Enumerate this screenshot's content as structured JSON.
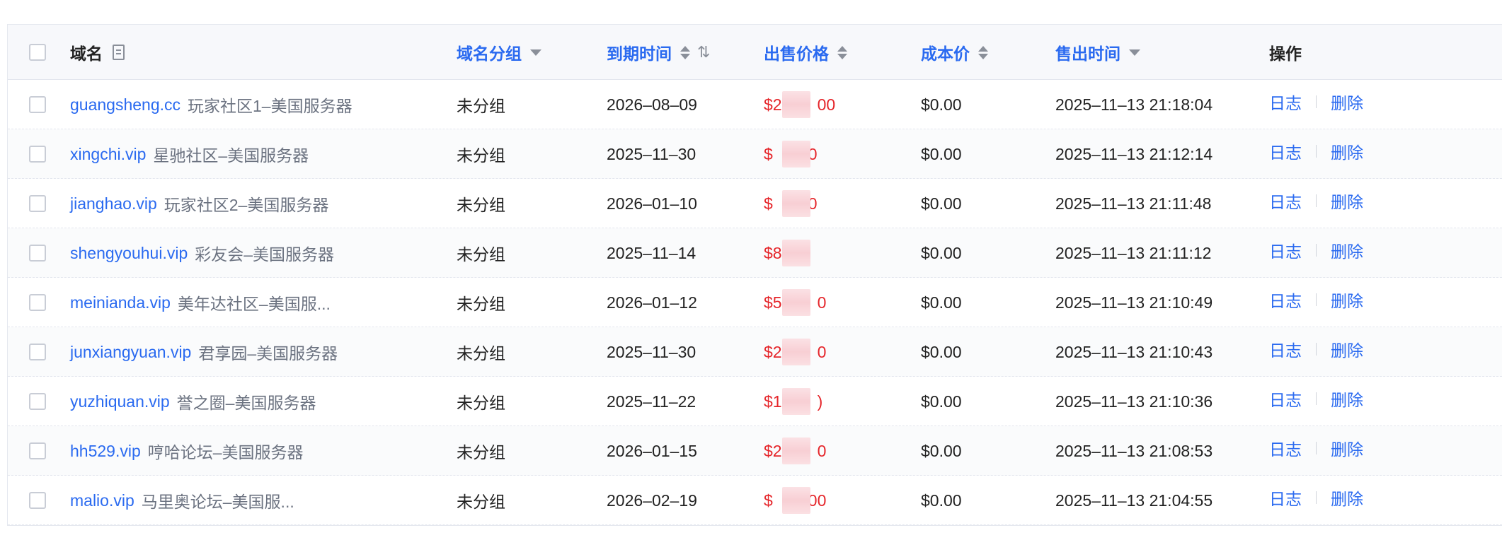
{
  "header": {
    "domain": "域名",
    "group": "域名分组",
    "expiry": "到期时间",
    "price": "出售价格",
    "cost": "成本价",
    "sold_time": "售出时间",
    "actions": "操作"
  },
  "icons": {
    "note": "note-icon",
    "filter": "caret-down-icon",
    "sort": "sort-icon",
    "sort_alt": "sort-alt-icon"
  },
  "colors": {
    "link": "#2a6af0",
    "price": "#e5252a",
    "header_bg": "#f7f8fb"
  },
  "rows": [
    {
      "domain": "guangsheng.cc",
      "note": "玩家社区1–美国服务器",
      "group": "未分组",
      "expiry": "2026–08–09",
      "price_prefix": "$2",
      "price_suffix": "00",
      "cost": "$0.00",
      "sold": "2025–11–13 21:18:04",
      "log": "日志",
      "delete": "删除"
    },
    {
      "domain": "xingchi.vip",
      "note": "星驰社区–美国服务器",
      "group": "未分组",
      "expiry": "2025–11–30",
      "price_prefix": "$",
      "price_suffix": "0",
      "cost": "$0.00",
      "sold": "2025–11–13 21:12:14",
      "log": "日志",
      "delete": "删除"
    },
    {
      "domain": "jianghao.vip",
      "note": "玩家社区2–美国服务器",
      "group": "未分组",
      "expiry": "2026–01–10",
      "price_prefix": "$",
      "price_suffix": "0",
      "cost": "$0.00",
      "sold": "2025–11–13 21:11:48",
      "log": "日志",
      "delete": "删除"
    },
    {
      "domain": "shengyouhui.vip",
      "note": "彩友会–美国服务器",
      "group": "未分组",
      "expiry": "2025–11–14",
      "price_prefix": "$8",
      "price_suffix": "",
      "cost": "$0.00",
      "sold": "2025–11–13 21:11:12",
      "log": "日志",
      "delete": "删除"
    },
    {
      "domain": "meinianda.vip",
      "note": "美年达社区–美国服...",
      "group": "未分组",
      "expiry": "2026–01–12",
      "price_prefix": "$5",
      "price_suffix": "0",
      "cost": "$0.00",
      "sold": "2025–11–13 21:10:49",
      "log": "日志",
      "delete": "删除"
    },
    {
      "domain": "junxiangyuan.vip",
      "note": "君享园–美国服务器",
      "group": "未分组",
      "expiry": "2025–11–30",
      "price_prefix": "$2",
      "price_suffix": "0",
      "cost": "$0.00",
      "sold": "2025–11–13 21:10:43",
      "log": "日志",
      "delete": "删除"
    },
    {
      "domain": "yuzhiquan.vip",
      "note": "誉之圈–美国服务器",
      "group": "未分组",
      "expiry": "2025–11–22",
      "price_prefix": "$1",
      "price_suffix": ")",
      "cost": "$0.00",
      "sold": "2025–11–13 21:10:36",
      "log": "日志",
      "delete": "删除"
    },
    {
      "domain": "hh529.vip",
      "note": "哼哈论坛–美国服务器",
      "group": "未分组",
      "expiry": "2026–01–15",
      "price_prefix": "$2",
      "price_suffix": "0",
      "cost": "$0.00",
      "sold": "2025–11–13 21:08:53",
      "log": "日志",
      "delete": "删除"
    },
    {
      "domain": "malio.vip",
      "note": "马里奥论坛–美国服...",
      "group": "未分组",
      "expiry": "2026–02–19",
      "price_prefix": "$",
      "price_suffix": "00",
      "cost": "$0.00",
      "sold": "2025–11–13 21:04:55",
      "log": "日志",
      "delete": "删除"
    }
  ]
}
